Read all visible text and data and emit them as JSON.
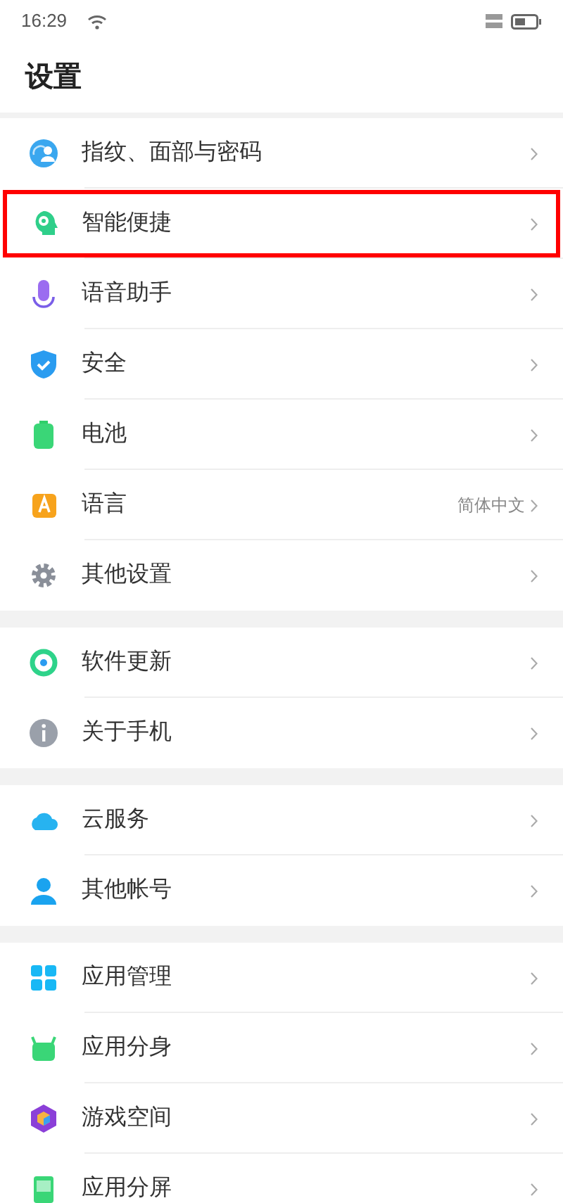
{
  "status_bar": {
    "time": "16:29"
  },
  "header": {
    "title": "设置"
  },
  "groups": [
    {
      "items": [
        {
          "label": "指纹、面部与密码",
          "highlighted": false
        },
        {
          "label": "智能便捷",
          "highlighted": true
        },
        {
          "label": "语音助手",
          "highlighted": false
        },
        {
          "label": "安全",
          "highlighted": false
        },
        {
          "label": "电池",
          "highlighted": false
        },
        {
          "label": "语言",
          "value": "简体中文",
          "highlighted": false
        },
        {
          "label": "其他设置",
          "highlighted": false
        }
      ]
    },
    {
      "items": [
        {
          "label": "软件更新",
          "highlighted": false
        },
        {
          "label": "关于手机",
          "highlighted": false
        }
      ]
    },
    {
      "items": [
        {
          "label": "云服务",
          "highlighted": false
        },
        {
          "label": "其他帐号",
          "highlighted": false
        }
      ]
    },
    {
      "items": [
        {
          "label": "应用管理",
          "highlighted": false
        },
        {
          "label": "应用分身",
          "highlighted": false
        },
        {
          "label": "游戏空间",
          "highlighted": false
        },
        {
          "label": "应用分屏",
          "highlighted": false
        }
      ]
    }
  ]
}
